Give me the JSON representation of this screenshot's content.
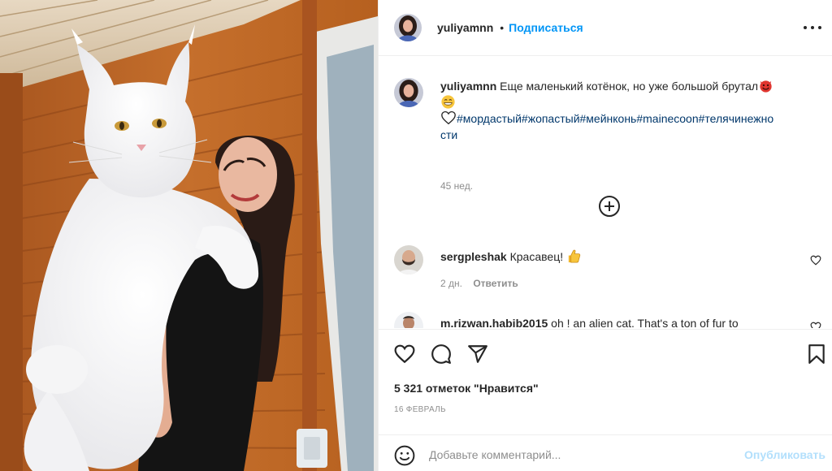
{
  "post": {
    "author": "yuliyamnn",
    "header": {
      "dot": "•",
      "follow_label": "Подписаться",
      "more_icon": "more-horizontal-icon"
    },
    "caption": {
      "username": "yuliyamnn",
      "text": "Еще маленький котёнок, но уже большой брутал",
      "emojis": [
        "smiling-devil-emoji",
        "grinning-emoji",
        "white-heart-emoji"
      ],
      "hashtags": [
        "#мордастый",
        "#жопастый",
        "#мейнконь",
        "#mainecoon",
        "#телячинежности"
      ],
      "hashtags_line1": "#мордастый#жопастый#мейнконь#mainecoon#телячинежно",
      "hashtags_line2": "сти",
      "time": "45 нед."
    },
    "load_more_icon": "plus-circle-icon",
    "comments": [
      {
        "username": "sergpleshak",
        "text": "Красавец!",
        "emoji": "thumbs-up-emoji",
        "time": "2 дн.",
        "reply_label": "Ответить"
      },
      {
        "username": "m.rizwan.habib2015",
        "text": "oh ! an alien cat. That's a ton of fur to"
      }
    ],
    "likes_text": "5 321 отметок \"Нравится\"",
    "date": "16 ФЕВРАЛЬ",
    "add_comment": {
      "placeholder": "Добавьте комментарий...",
      "post_label": "Опубликовать"
    }
  },
  "colors": {
    "accent": "#0095f6",
    "accent_disabled": "#b2dffc",
    "hashtag": "#00376b",
    "muted": "#8e8e8e",
    "text": "#262626",
    "border": "#efefef"
  }
}
